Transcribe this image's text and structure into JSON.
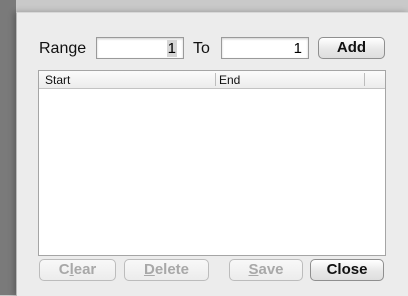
{
  "range": {
    "label": "Range",
    "from_value": "1",
    "to_label": "To",
    "to_value": "1",
    "add_label": "Add"
  },
  "table": {
    "columns": [
      "Start",
      "End"
    ]
  },
  "buttons": {
    "clear_pre": "C",
    "clear_underlined": "l",
    "clear_post": "ear",
    "delete_underlined": "D",
    "delete_post": "elete",
    "save_underlined": "S",
    "save_post": "ave",
    "close_label": "Close"
  }
}
